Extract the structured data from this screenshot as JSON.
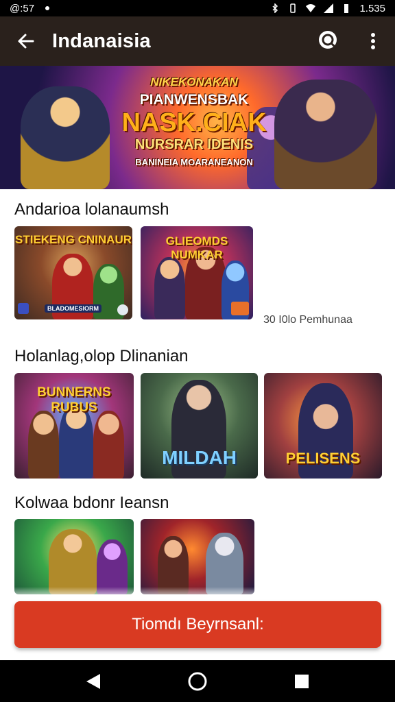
{
  "status_bar": {
    "time": "@:57",
    "battery": "1.535"
  },
  "app_bar": {
    "title": "Indanaisia"
  },
  "banner": {
    "line1": "NIKEKONAKAN",
    "line2": "PIANWENSBAK",
    "line3": "NASK.CIAK",
    "line4": "NURSRAR IDENIS",
    "line5": "BANINEIA MOARANEANON"
  },
  "sections": [
    {
      "title": "Andarioa lolanaumsh",
      "meta": "30 I0lo Pemhunaa",
      "items": [
        {
          "overlay": "STIEKENG CNINAUR",
          "badge": "BLADOMESIORM"
        },
        {
          "overlay": "GLIEOMDS NUMKAR",
          "badge": ""
        }
      ]
    },
    {
      "title": "Holanlag,olop Dlinanian",
      "items": [
        {
          "overlay": "BUNNERNS RUBUS"
        },
        {
          "overlay": "MILDAH"
        },
        {
          "overlay": "PELISENS"
        }
      ]
    },
    {
      "title": "Kolwaa bdonr Ieansn",
      "items": [
        {
          "overlay": ""
        },
        {
          "overlay": ""
        }
      ]
    }
  ],
  "cta": {
    "label": "Tiomdı Beyrnsanl:"
  },
  "colors": {
    "app_bar": "#2a211c",
    "cta": "#d93a22"
  }
}
